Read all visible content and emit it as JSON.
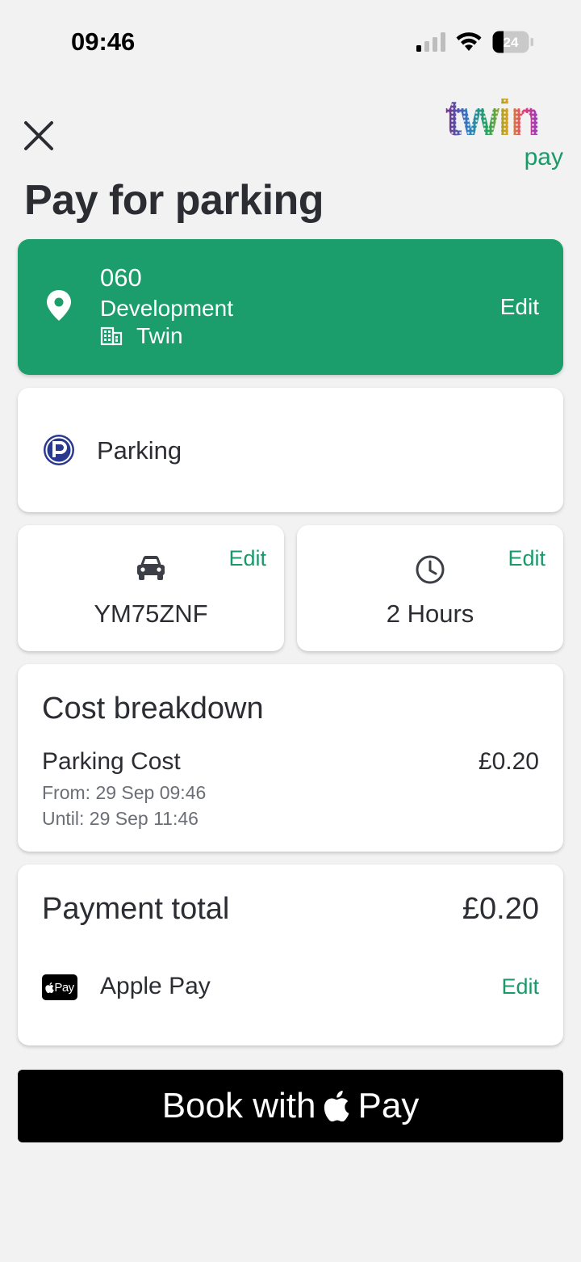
{
  "status": {
    "time": "09:46",
    "battery": "24"
  },
  "header": {
    "logo_word": "twin",
    "logo_sub": "pay",
    "title": "Pay for parking"
  },
  "location": {
    "code": "060",
    "name": "Development",
    "company": "Twin",
    "edit_label": "Edit"
  },
  "parking": {
    "label": "Parking"
  },
  "vehicle": {
    "plate": "YM75ZNF",
    "edit_label": "Edit"
  },
  "duration": {
    "value": "2 Hours",
    "edit_label": "Edit"
  },
  "cost_breakdown": {
    "title": "Cost breakdown",
    "item_label": "Parking Cost",
    "item_value": "£0.20",
    "from": "From: 29 Sep 09:46",
    "until": "Until: 29 Sep 11:46"
  },
  "payment": {
    "title": "Payment total",
    "total": "£0.20",
    "badge_text": "Pay",
    "method": "Apple Pay",
    "edit_label": "Edit"
  },
  "book_button": {
    "prefix": "Book with",
    "suffix": "Pay"
  },
  "colors": {
    "brand_green": "#1b9e6b",
    "link_green": "#1a9a6a",
    "parking_blue": "#2a3990",
    "text": "#2b2d33"
  }
}
